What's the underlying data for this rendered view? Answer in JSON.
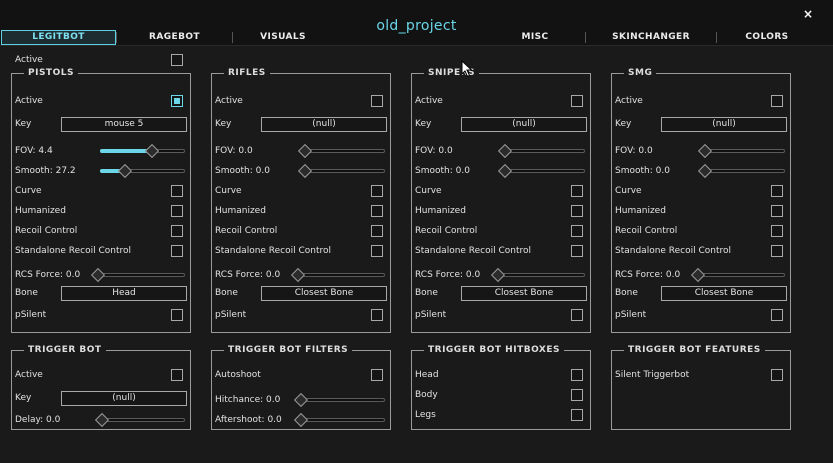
{
  "window": {
    "title": "old_project",
    "close_glyph": "×",
    "accent_color": "#6ad6e8"
  },
  "tabs": [
    "LEGITBOT",
    "RAGEBOT",
    "VISUALS",
    "MISC",
    "SKINCHANGER",
    "COLORS"
  ],
  "active_tab": "LEGITBOT",
  "global": {
    "active_label": "Active",
    "active": false
  },
  "weapon_panels": [
    {
      "title": "PISTOLS",
      "active_label": "Active",
      "active": true,
      "key_label": "Key",
      "key_value": "mouse 5",
      "fov_label": "FOV: 4.4",
      "fov_value": 4.4,
      "fov_fraction": 0.62,
      "smooth_label": "Smooth: 27.2",
      "smooth_value": 27.2,
      "smooth_fraction": 0.27,
      "curve_label": "Curve",
      "curve": false,
      "humanized_label": "Humanized",
      "humanized": false,
      "recoil_label": "Recoil Control",
      "recoil": false,
      "standalone_label": "Standalone Recoil Control",
      "standalone": false,
      "rcs_label": "RCS Force: 0.0",
      "rcs_value": 0.0,
      "rcs_fraction": 0,
      "bone_label": "Bone",
      "bone_value": "Head",
      "psilent_label": "pSilent",
      "psilent": false
    },
    {
      "title": "RIFLES",
      "active_label": "Active",
      "active": false,
      "key_label": "Key",
      "key_value": "(null)",
      "fov_label": "FOV: 0.0",
      "fov_value": 0.0,
      "fov_fraction": 0,
      "smooth_label": "Smooth: 0.0",
      "smooth_value": 0.0,
      "smooth_fraction": 0,
      "curve_label": "Curve",
      "curve": false,
      "humanized_label": "Humanized",
      "humanized": false,
      "recoil_label": "Recoil Control",
      "recoil": false,
      "standalone_label": "Standalone Recoil Control",
      "standalone": false,
      "rcs_label": "RCS Force: 0.0",
      "rcs_value": 0.0,
      "rcs_fraction": 0,
      "bone_label": "Bone",
      "bone_value": "Closest Bone",
      "psilent_label": "pSilent",
      "psilent": false
    },
    {
      "title": "SNIPERS",
      "active_label": "Active",
      "active": false,
      "key_label": "Key",
      "key_value": "(null)",
      "fov_label": "FOV: 0.0",
      "fov_value": 0.0,
      "fov_fraction": 0,
      "smooth_label": "Smooth: 0.0",
      "smooth_value": 0.0,
      "smooth_fraction": 0,
      "curve_label": "Curve",
      "curve": false,
      "humanized_label": "Humanized",
      "humanized": false,
      "recoil_label": "Recoil Control",
      "recoil": false,
      "standalone_label": "Standalone Recoil Control",
      "standalone": false,
      "rcs_label": "RCS Force: 0.0",
      "rcs_value": 0.0,
      "rcs_fraction": 0,
      "bone_label": "Bone",
      "bone_value": "Closest Bone",
      "psilent_label": "pSilent",
      "psilent": false
    },
    {
      "title": "SMG",
      "active_label": "Active",
      "active": false,
      "key_label": "Key",
      "key_value": "(null)",
      "fov_label": "FOV: 0.0",
      "fov_value": 0.0,
      "fov_fraction": 0,
      "smooth_label": "Smooth: 0.0",
      "smooth_value": 0.0,
      "smooth_fraction": 0,
      "curve_label": "Curve",
      "curve": false,
      "humanized_label": "Humanized",
      "humanized": false,
      "recoil_label": "Recoil Control",
      "recoil": false,
      "standalone_label": "Standalone Recoil Control",
      "standalone": false,
      "rcs_label": "RCS Force: 0.0",
      "rcs_value": 0.0,
      "rcs_fraction": 0,
      "bone_label": "Bone",
      "bone_value": "Closest Bone",
      "psilent_label": "pSilent",
      "psilent": false
    }
  ],
  "trigger_bot": {
    "title": "TRIGGER BOT",
    "active_label": "Active",
    "active": false,
    "key_label": "Key",
    "key_value": "(null)",
    "delay_label": "Delay: 0.0",
    "delay_value": 0.0,
    "delay_fraction": 0
  },
  "trigger_filters": {
    "title": "TRIGGER BOT FILTERS",
    "autoshoot_label": "Autoshoot",
    "autoshoot": false,
    "hitchance_label": "Hitchance: 0.0",
    "hitchance_value": 0.0,
    "hitchance_fraction": 0,
    "aftershoot_label": "Aftershoot: 0.0",
    "aftershoot_value": 0.0,
    "aftershoot_fraction": 0
  },
  "trigger_hitboxes": {
    "title": "TRIGGER BOT HITBOXES",
    "head_label": "Head",
    "head": false,
    "body_label": "Body",
    "body": false,
    "legs_label": "Legs",
    "legs": false
  },
  "trigger_features": {
    "title": "TRIGGER BOT FEATURES",
    "silent_label": "Silent Triggerbot",
    "silent": false
  }
}
